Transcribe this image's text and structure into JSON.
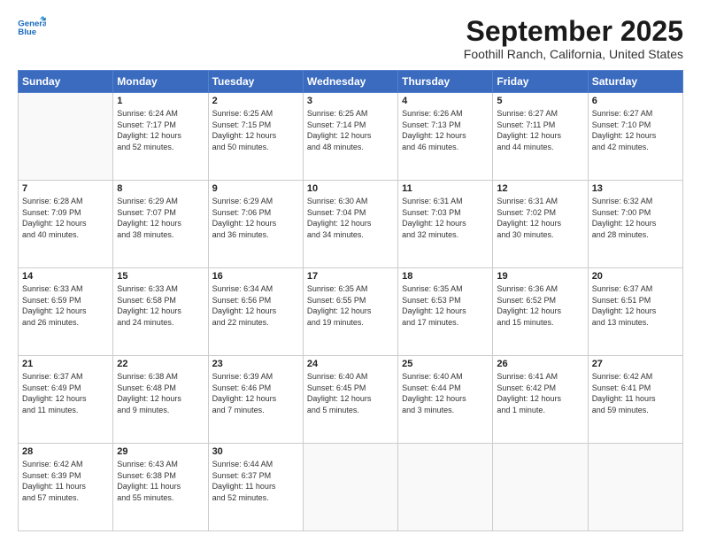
{
  "logo": {
    "line1": "General",
    "line2": "Blue"
  },
  "title": "September 2025",
  "location": "Foothill Ranch, California, United States",
  "days_of_week": [
    "Sunday",
    "Monday",
    "Tuesday",
    "Wednesday",
    "Thursday",
    "Friday",
    "Saturday"
  ],
  "weeks": [
    [
      {
        "day": "",
        "info": ""
      },
      {
        "day": "1",
        "info": "Sunrise: 6:24 AM\nSunset: 7:17 PM\nDaylight: 12 hours\nand 52 minutes."
      },
      {
        "day": "2",
        "info": "Sunrise: 6:25 AM\nSunset: 7:15 PM\nDaylight: 12 hours\nand 50 minutes."
      },
      {
        "day": "3",
        "info": "Sunrise: 6:25 AM\nSunset: 7:14 PM\nDaylight: 12 hours\nand 48 minutes."
      },
      {
        "day": "4",
        "info": "Sunrise: 6:26 AM\nSunset: 7:13 PM\nDaylight: 12 hours\nand 46 minutes."
      },
      {
        "day": "5",
        "info": "Sunrise: 6:27 AM\nSunset: 7:11 PM\nDaylight: 12 hours\nand 44 minutes."
      },
      {
        "day": "6",
        "info": "Sunrise: 6:27 AM\nSunset: 7:10 PM\nDaylight: 12 hours\nand 42 minutes."
      }
    ],
    [
      {
        "day": "7",
        "info": "Sunrise: 6:28 AM\nSunset: 7:09 PM\nDaylight: 12 hours\nand 40 minutes."
      },
      {
        "day": "8",
        "info": "Sunrise: 6:29 AM\nSunset: 7:07 PM\nDaylight: 12 hours\nand 38 minutes."
      },
      {
        "day": "9",
        "info": "Sunrise: 6:29 AM\nSunset: 7:06 PM\nDaylight: 12 hours\nand 36 minutes."
      },
      {
        "day": "10",
        "info": "Sunrise: 6:30 AM\nSunset: 7:04 PM\nDaylight: 12 hours\nand 34 minutes."
      },
      {
        "day": "11",
        "info": "Sunrise: 6:31 AM\nSunset: 7:03 PM\nDaylight: 12 hours\nand 32 minutes."
      },
      {
        "day": "12",
        "info": "Sunrise: 6:31 AM\nSunset: 7:02 PM\nDaylight: 12 hours\nand 30 minutes."
      },
      {
        "day": "13",
        "info": "Sunrise: 6:32 AM\nSunset: 7:00 PM\nDaylight: 12 hours\nand 28 minutes."
      }
    ],
    [
      {
        "day": "14",
        "info": "Sunrise: 6:33 AM\nSunset: 6:59 PM\nDaylight: 12 hours\nand 26 minutes."
      },
      {
        "day": "15",
        "info": "Sunrise: 6:33 AM\nSunset: 6:58 PM\nDaylight: 12 hours\nand 24 minutes."
      },
      {
        "day": "16",
        "info": "Sunrise: 6:34 AM\nSunset: 6:56 PM\nDaylight: 12 hours\nand 22 minutes."
      },
      {
        "day": "17",
        "info": "Sunrise: 6:35 AM\nSunset: 6:55 PM\nDaylight: 12 hours\nand 19 minutes."
      },
      {
        "day": "18",
        "info": "Sunrise: 6:35 AM\nSunset: 6:53 PM\nDaylight: 12 hours\nand 17 minutes."
      },
      {
        "day": "19",
        "info": "Sunrise: 6:36 AM\nSunset: 6:52 PM\nDaylight: 12 hours\nand 15 minutes."
      },
      {
        "day": "20",
        "info": "Sunrise: 6:37 AM\nSunset: 6:51 PM\nDaylight: 12 hours\nand 13 minutes."
      }
    ],
    [
      {
        "day": "21",
        "info": "Sunrise: 6:37 AM\nSunset: 6:49 PM\nDaylight: 12 hours\nand 11 minutes."
      },
      {
        "day": "22",
        "info": "Sunrise: 6:38 AM\nSunset: 6:48 PM\nDaylight: 12 hours\nand 9 minutes."
      },
      {
        "day": "23",
        "info": "Sunrise: 6:39 AM\nSunset: 6:46 PM\nDaylight: 12 hours\nand 7 minutes."
      },
      {
        "day": "24",
        "info": "Sunrise: 6:40 AM\nSunset: 6:45 PM\nDaylight: 12 hours\nand 5 minutes."
      },
      {
        "day": "25",
        "info": "Sunrise: 6:40 AM\nSunset: 6:44 PM\nDaylight: 12 hours\nand 3 minutes."
      },
      {
        "day": "26",
        "info": "Sunrise: 6:41 AM\nSunset: 6:42 PM\nDaylight: 12 hours\nand 1 minute."
      },
      {
        "day": "27",
        "info": "Sunrise: 6:42 AM\nSunset: 6:41 PM\nDaylight: 11 hours\nand 59 minutes."
      }
    ],
    [
      {
        "day": "28",
        "info": "Sunrise: 6:42 AM\nSunset: 6:39 PM\nDaylight: 11 hours\nand 57 minutes."
      },
      {
        "day": "29",
        "info": "Sunrise: 6:43 AM\nSunset: 6:38 PM\nDaylight: 11 hours\nand 55 minutes."
      },
      {
        "day": "30",
        "info": "Sunrise: 6:44 AM\nSunset: 6:37 PM\nDaylight: 11 hours\nand 52 minutes."
      },
      {
        "day": "",
        "info": ""
      },
      {
        "day": "",
        "info": ""
      },
      {
        "day": "",
        "info": ""
      },
      {
        "day": "",
        "info": ""
      }
    ]
  ]
}
